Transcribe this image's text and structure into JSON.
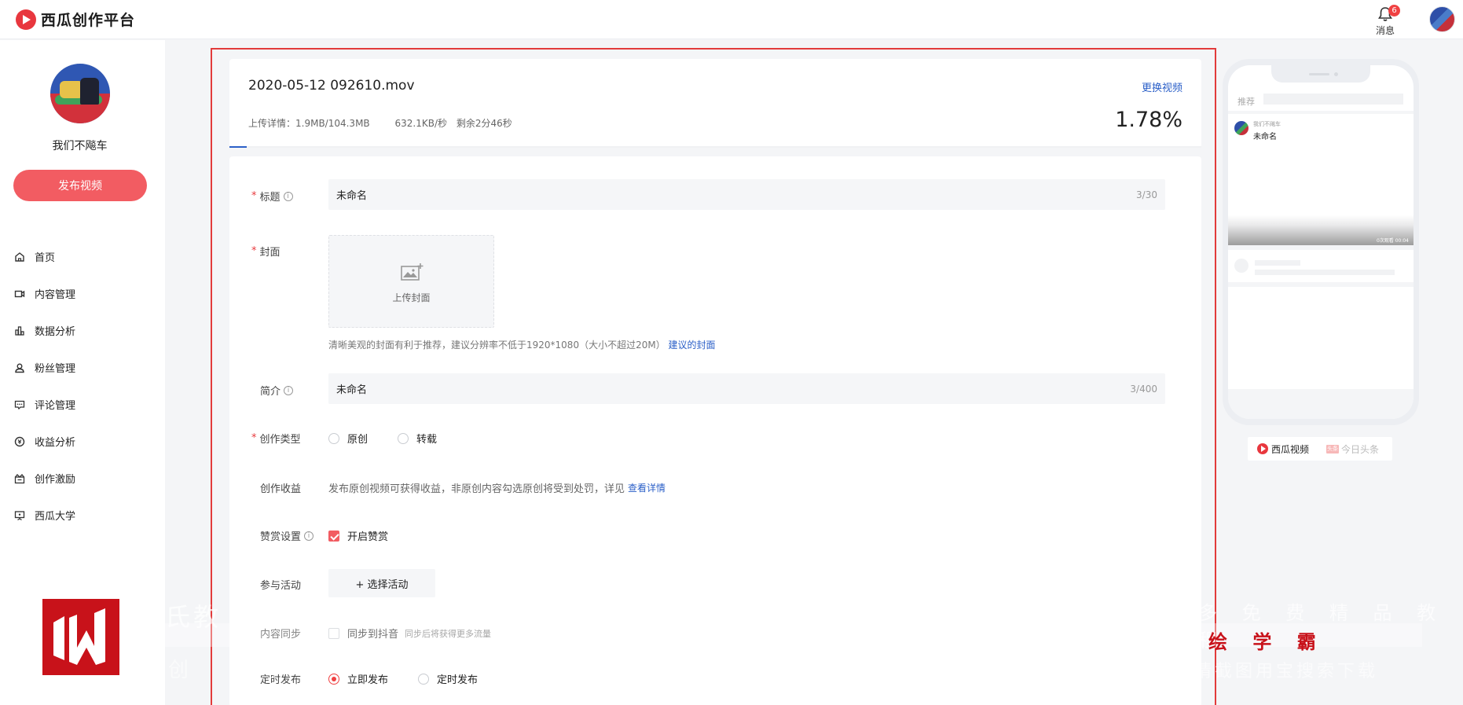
{
  "app": {
    "logo_text": "西瓜创作平台",
    "messages_label": "消息",
    "messages_count": "6"
  },
  "sidebar": {
    "username": "我们不飚车",
    "publish_label": "发布视频",
    "items": [
      {
        "label": "首页",
        "icon": "home-icon"
      },
      {
        "label": "内容管理",
        "icon": "video-camera-icon"
      },
      {
        "label": "数据分析",
        "icon": "bar-chart-icon"
      },
      {
        "label": "粉丝管理",
        "icon": "user-icon"
      },
      {
        "label": "评论管理",
        "icon": "comment-icon"
      },
      {
        "label": "收益分析",
        "icon": "coin-icon"
      },
      {
        "label": "创作激励",
        "icon": "gift-icon"
      },
      {
        "label": "西瓜大学",
        "icon": "presentation-icon"
      }
    ]
  },
  "upload": {
    "file_name": "2020-05-12 092610.mov",
    "change_label": "更换视频",
    "detail": "上传详情：1.9MB/104.3MB",
    "speed": "632.1KB/秒",
    "remaining": "剩余2分46秒",
    "percent": "1.78%",
    "progress": 0.0178
  },
  "form": {
    "title": {
      "label": "标题",
      "value": "未命名",
      "count": "3/30"
    },
    "cover": {
      "label": "封面",
      "upload_label": "上传封面",
      "hint": "清晰美观的封面有利于推荐，建议分辨率不低于1920*1080（大小不超过20M）",
      "hint_link": "建议的封面"
    },
    "intro": {
      "label": "简介",
      "value": "未命名",
      "count": "3/400"
    },
    "type": {
      "label": "创作类型",
      "options": [
        "原创",
        "转载"
      ]
    },
    "income": {
      "label": "创作收益",
      "text": "发布原创视频可获得收益，非原创内容勾选原创将受到处罚，详见",
      "link": "查看详情"
    },
    "reward": {
      "label": "赞赏设置",
      "checkbox_label": "开启赞赏"
    },
    "activity": {
      "label": "参与活动",
      "button": "+ 选择活动"
    },
    "sync": {
      "label": "内容同步",
      "checkbox_label": "同步到抖音",
      "hint": "同步后将获得更多流量"
    },
    "schedule": {
      "label": "定时发布",
      "options": [
        "立即发布",
        "定时发布"
      ]
    }
  },
  "preview": {
    "recommend_label": "推荐",
    "author": "我们不飚车",
    "title": "未命名",
    "video_meta": "0次观看   00:04",
    "platform_xigua": "西瓜视频",
    "platform_toutiao": "今日头条",
    "toutiao_badge": "头条"
  },
  "watermark": {
    "left_text": "氏教",
    "left_text2": "创 可",
    "right_text": "多 免 费 精 品 教 程",
    "brand": "绘 学 霸",
    "right_text2": "请截图用宝搜索下载"
  },
  "colors": {
    "accent": "#f25c62",
    "brand_red": "#e8373e",
    "link": "#2c60c8"
  }
}
